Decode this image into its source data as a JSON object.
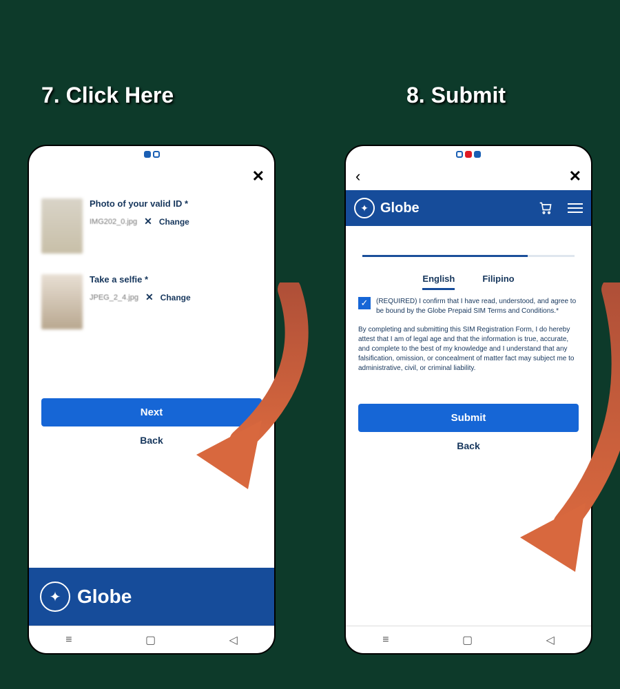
{
  "steps": {
    "seven": "7. Click Here",
    "eight": "8. Submit"
  },
  "brand": "Globe",
  "left": {
    "section1": {
      "title": "Photo of your valid ID *",
      "filename": "IMG202_0.jpg",
      "change": "Change"
    },
    "section2": {
      "title": "Take a selfie *",
      "filename": "JPEG_2_4.jpg",
      "change": "Change"
    },
    "next": "Next",
    "back": "Back"
  },
  "right": {
    "tabs": {
      "english": "English",
      "filipino": "Filipino"
    },
    "required": "(REQUIRED) I confirm that I have read, understood, and agree to be bound by the Globe Prepaid SIM Terms and Conditions.*",
    "body": "By completing and submitting this SIM Registration Form, I do hereby attest that I am of legal age and that the information is true, accurate, and complete to the best of my knowledge and I understand that any falsification, omission, or concealment of matter fact may subject me to administrative, civil, or criminal liability.",
    "submit": "Submit",
    "back": "Back"
  }
}
